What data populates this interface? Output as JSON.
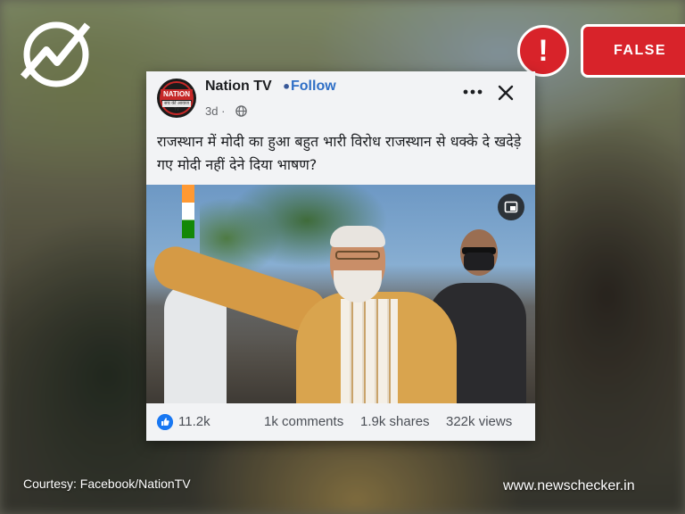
{
  "verdict": {
    "alert_symbol": "!",
    "label": "FALSE",
    "color": "#d8232a"
  },
  "logo": {
    "icon": "newschecker-logo-icon"
  },
  "post": {
    "page_name": "Nation TV",
    "separator": "•",
    "follow_label": "Follow",
    "time": "3d",
    "time_separator": "·",
    "privacy_icon": "globe-icon",
    "avatar": {
      "line1": "NATION",
      "line2": "सच की आवाज TV"
    },
    "caption": "राजस्थान में मोदी का हुआ बहुत भारी विरोध राजस्थान से धक्के दे खदेड़े गए मोदी नहीं देने दिया भाषण?",
    "media_icon": "picture-in-picture-icon",
    "stats": {
      "likes": "11.2k",
      "comments": "1k comments",
      "shares": "1.9k shares",
      "views": "322k views"
    }
  },
  "footer": {
    "courtesy": "Courtesy: Facebook/NationTV",
    "site": "www.newschecker.in"
  }
}
